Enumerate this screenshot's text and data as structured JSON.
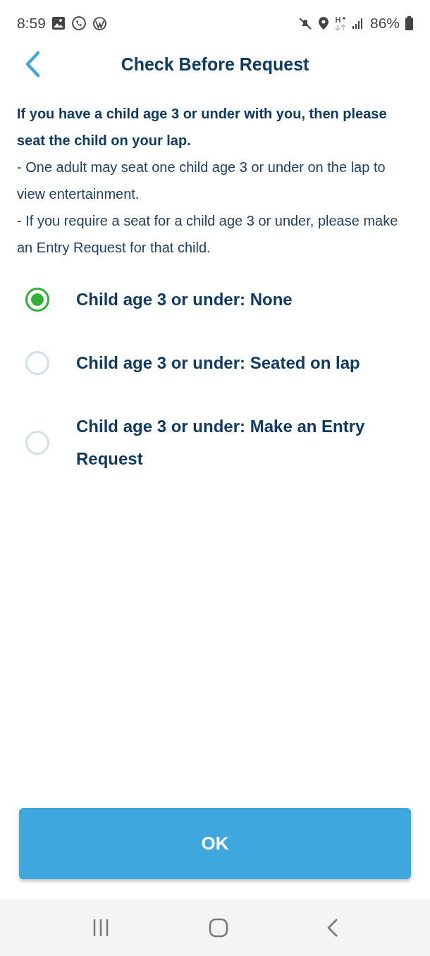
{
  "status_bar": {
    "time": "8:59",
    "battery": "86%"
  },
  "header": {
    "title": "Check Before Request"
  },
  "intro": {
    "heading": "If you have a child age 3 or under with you, then please seat the child on your lap.",
    "lines": [
      "- One adult may seat one child age 3 or under on the lap to view entertainment.",
      "- If you require a seat for a child age 3 or under, please make an Entry Request for that child."
    ]
  },
  "options": [
    {
      "label": "Child age 3 or under: None",
      "selected": true
    },
    {
      "label": "Child age 3 or under: Seated on lap",
      "selected": false
    },
    {
      "label": "Child age 3 or under: Make an Entry Request",
      "selected": false
    }
  ],
  "ok_button": {
    "label": "OK"
  }
}
